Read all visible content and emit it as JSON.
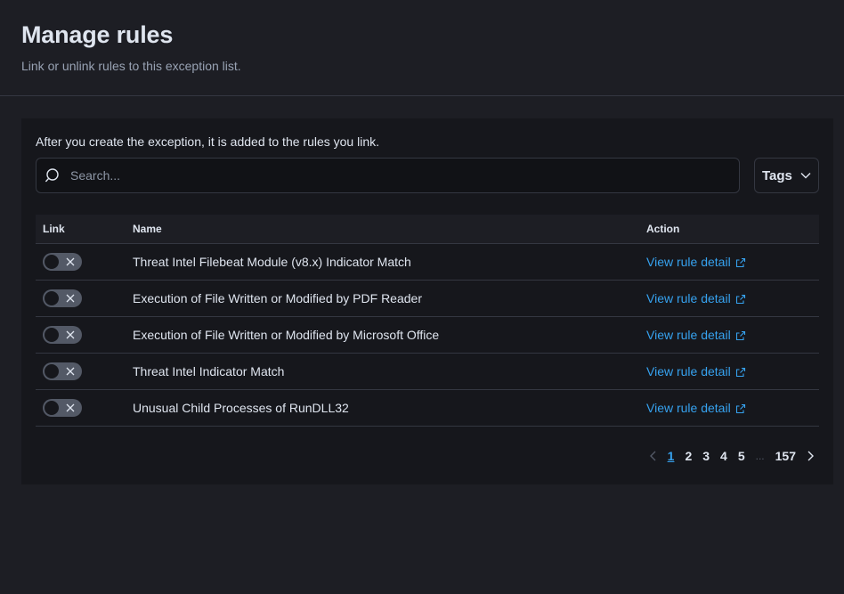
{
  "header": {
    "title": "Manage rules",
    "subtitle": "Link or unlink rules to this exception list."
  },
  "panel": {
    "description": "After you create the exception, it is added to the rules you link.",
    "search": {
      "placeholder": "Search...",
      "value": ""
    },
    "tags_label": "Tags"
  },
  "table": {
    "columns": {
      "link": "Link",
      "name": "Name",
      "action": "Action"
    },
    "rows": [
      {
        "name": "Threat Intel Filebeat Module (v8.x) Indicator Match",
        "action": "View rule detail",
        "linked": false
      },
      {
        "name": "Execution of File Written or Modified by PDF Reader",
        "action": "View rule detail",
        "linked": false
      },
      {
        "name": "Execution of File Written or Modified by Microsoft Office",
        "action": "View rule detail",
        "linked": false
      },
      {
        "name": "Threat Intel Indicator Match",
        "action": "View rule detail",
        "linked": false
      },
      {
        "name": "Unusual Child Processes of RunDLL32",
        "action": "View rule detail",
        "linked": false
      }
    ]
  },
  "pagination": {
    "pages": [
      "1",
      "2",
      "3",
      "4",
      "5"
    ],
    "ellipsis": "...",
    "last": "157",
    "current": "1"
  },
  "colors": {
    "background": "#1d1e24",
    "panel": "#16171c",
    "link": "#36a2ef",
    "border": "#343741"
  },
  "icons": [
    "search-icon",
    "chevron-down-icon",
    "close-icon",
    "external-link-icon",
    "chevron-left-icon",
    "chevron-right-icon"
  ]
}
